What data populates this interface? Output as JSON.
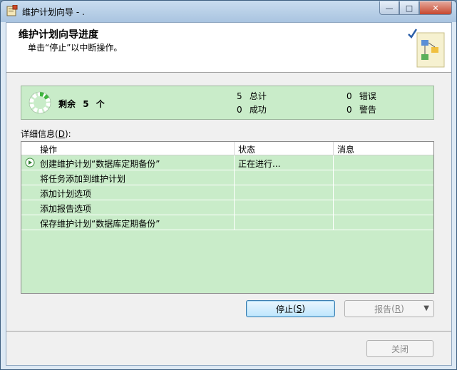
{
  "window": {
    "title": "维护计划向导 - ."
  },
  "header": {
    "title": "维护计划向导进度",
    "subtitle": "单击“停止”以中断操作。"
  },
  "status": {
    "remaining_label": "剩余",
    "remaining_count": "5",
    "remaining_unit": "个",
    "total_count": "5",
    "total_label": "总计",
    "success_count": "0",
    "success_label": "成功",
    "error_count": "0",
    "error_label": "错误",
    "warning_count": "0",
    "warning_label": "警告"
  },
  "details": {
    "label": "详细信息",
    "mnemonic": "D",
    "columns": [
      "操作",
      "状态",
      "消息"
    ],
    "rows": [
      {
        "action": "创建维护计划“数据库定期备份”",
        "status": "正在进行...",
        "message": ""
      },
      {
        "action": "将任务添加到维护计划",
        "status": "",
        "message": ""
      },
      {
        "action": "添加计划选项",
        "status": "",
        "message": ""
      },
      {
        "action": "添加报告选项",
        "status": "",
        "message": ""
      },
      {
        "action": "保存维护计划“数据库定期备份”",
        "status": "",
        "message": ""
      }
    ]
  },
  "buttons": {
    "stop_label": "停止",
    "stop_key": "S",
    "report_label": "报告",
    "report_key": "R",
    "close_label": "关闭"
  },
  "colors": {
    "progress_green": "#c9ecc9",
    "title_bar": "#a9c4e0"
  }
}
